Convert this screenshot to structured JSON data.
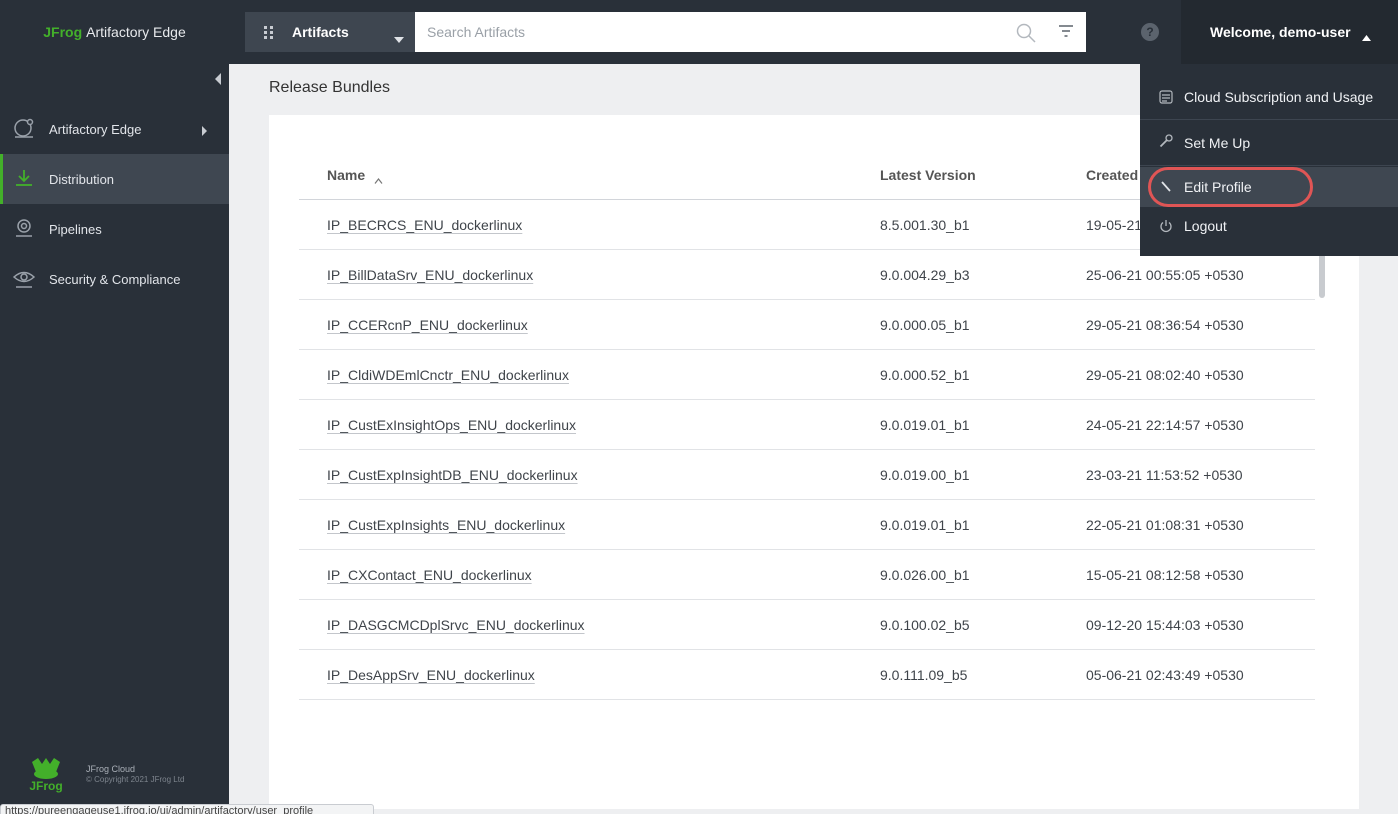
{
  "brand": {
    "jf": "JFrog",
    "product": "Artifactory Edge"
  },
  "sidebar": {
    "items": [
      {
        "label": "Artifactory Edge",
        "icon": "artifactory-icon",
        "active": false,
        "has_arrow": true
      },
      {
        "label": "Distribution",
        "icon": "download-icon",
        "active": true,
        "has_arrow": false
      },
      {
        "label": "Pipelines",
        "icon": "pipelines-icon",
        "active": false,
        "has_arrow": false
      },
      {
        "label": "Security & Compliance",
        "icon": "eye-icon",
        "active": false,
        "has_arrow": false
      }
    ],
    "footer": {
      "line1": "JFrog Cloud",
      "line2": "© Copyright 2021 JFrog Ltd"
    }
  },
  "topbar": {
    "package_select": {
      "label": "Artifacts",
      "icon": "grid-icon"
    },
    "search": {
      "placeholder": "Search Artifacts",
      "value": ""
    },
    "help_glyph": "?",
    "welcome": "Welcome, demo-user"
  },
  "user_dropdown": {
    "items": [
      {
        "label": "Cloud Subscription and Usage",
        "icon": "subscription-icon"
      },
      {
        "label": "Set Me Up",
        "icon": "wrench-icon"
      },
      {
        "label": "Edit Profile",
        "icon": "pencil-icon",
        "highlighted": true
      },
      {
        "label": "Logout",
        "icon": "power-icon"
      }
    ]
  },
  "main": {
    "title": "Release Bundles",
    "table": {
      "columns": [
        "Name",
        "Latest Version",
        "Created"
      ],
      "sort": {
        "column": "Name",
        "direction": "ascending"
      },
      "rows": [
        {
          "name": "IP_BECRCS_ENU_dockerlinux",
          "version": "8.5.001.30_b1",
          "created": "19-05-21"
        },
        {
          "name": "IP_BillDataSrv_ENU_dockerlinux",
          "version": "9.0.004.29_b3",
          "created": "25-06-21 00:55:05 +0530"
        },
        {
          "name": "IP_CCERcnP_ENU_dockerlinux",
          "version": "9.0.000.05_b1",
          "created": "29-05-21 08:36:54 +0530"
        },
        {
          "name": "IP_CldiWDEmlCnctr_ENU_dockerlinux",
          "version": "9.0.000.52_b1",
          "created": "29-05-21 08:02:40 +0530"
        },
        {
          "name": "IP_CustExInsightOps_ENU_dockerlinux",
          "version": "9.0.019.01_b1",
          "created": "24-05-21 22:14:57 +0530"
        },
        {
          "name": "IP_CustExpInsightDB_ENU_dockerlinux",
          "version": "9.0.019.00_b1",
          "created": "23-03-21 11:53:52 +0530"
        },
        {
          "name": "IP_CustExpInsights_ENU_dockerlinux",
          "version": "9.0.019.01_b1",
          "created": "22-05-21 01:08:31 +0530"
        },
        {
          "name": "IP_CXContact_ENU_dockerlinux",
          "version": "9.0.026.00_b1",
          "created": "15-05-21 08:12:58 +0530"
        },
        {
          "name": "IP_DASGCMCDplSrvc_ENU_dockerlinux",
          "version": "9.0.100.02_b5",
          "created": "09-12-20 15:44:03 +0530"
        },
        {
          "name": "IP_DesAppSrv_ENU_dockerlinux",
          "version": "9.0.111.09_b5",
          "created": "05-06-21 02:43:49 +0530"
        }
      ]
    }
  },
  "statusbar": {
    "url": "https://pureengageuse1.jfrog.io/ui/admin/artifactory/user_profile"
  },
  "colors": {
    "accent": "#43b02a",
    "sidebar_bg": "#293039",
    "active_bg": "#3f4751",
    "highlight_ring": "#e05555"
  }
}
